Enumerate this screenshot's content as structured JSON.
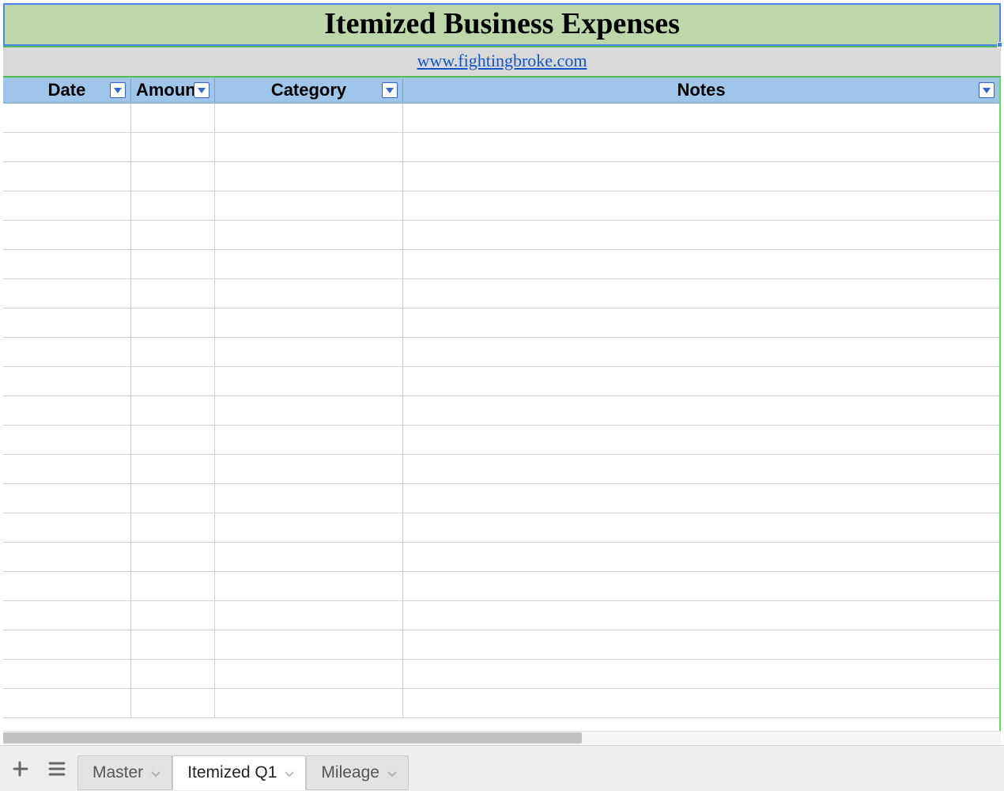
{
  "title": "Itemized Business Expenses",
  "link": {
    "text": "www.fightingbroke.com"
  },
  "columns": {
    "date": {
      "label": "Date",
      "has_filter": true
    },
    "amount": {
      "label": "Amount",
      "has_filter": true
    },
    "cat": {
      "label": "Category",
      "has_filter": true
    },
    "notes": {
      "label": "Notes",
      "has_filter": true
    }
  },
  "rows": [
    {
      "date": "",
      "amount": "",
      "cat": "",
      "notes": ""
    },
    {
      "date": "",
      "amount": "",
      "cat": "",
      "notes": ""
    },
    {
      "date": "",
      "amount": "",
      "cat": "",
      "notes": ""
    },
    {
      "date": "",
      "amount": "",
      "cat": "",
      "notes": ""
    },
    {
      "date": "",
      "amount": "",
      "cat": "",
      "notes": ""
    },
    {
      "date": "",
      "amount": "",
      "cat": "",
      "notes": ""
    },
    {
      "date": "",
      "amount": "",
      "cat": "",
      "notes": ""
    },
    {
      "date": "",
      "amount": "",
      "cat": "",
      "notes": ""
    },
    {
      "date": "",
      "amount": "",
      "cat": "",
      "notes": ""
    },
    {
      "date": "",
      "amount": "",
      "cat": "",
      "notes": ""
    },
    {
      "date": "",
      "amount": "",
      "cat": "",
      "notes": ""
    },
    {
      "date": "",
      "amount": "",
      "cat": "",
      "notes": ""
    },
    {
      "date": "",
      "amount": "",
      "cat": "",
      "notes": ""
    },
    {
      "date": "",
      "amount": "",
      "cat": "",
      "notes": ""
    },
    {
      "date": "",
      "amount": "",
      "cat": "",
      "notes": ""
    },
    {
      "date": "",
      "amount": "",
      "cat": "",
      "notes": ""
    },
    {
      "date": "",
      "amount": "",
      "cat": "",
      "notes": ""
    },
    {
      "date": "",
      "amount": "",
      "cat": "",
      "notes": ""
    },
    {
      "date": "",
      "amount": "",
      "cat": "",
      "notes": ""
    },
    {
      "date": "",
      "amount": "",
      "cat": "",
      "notes": ""
    },
    {
      "date": "",
      "amount": "",
      "cat": "",
      "notes": ""
    }
  ],
  "tabs": [
    {
      "label": "Master",
      "active": false
    },
    {
      "label": "Itemized Q1",
      "active": true
    },
    {
      "label": "Mileage",
      "active": false
    }
  ],
  "colors": {
    "title_bg": "#bdd7aa",
    "selection_border": "#4a86e8",
    "header_bg": "#9fc5e8",
    "green_border": "#58b858",
    "link": "#1155cc"
  }
}
